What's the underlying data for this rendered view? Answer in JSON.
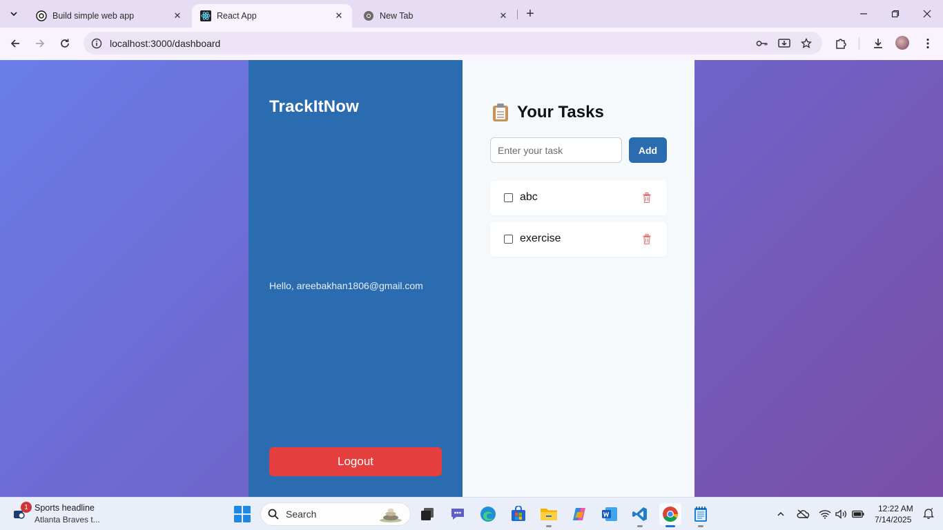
{
  "browser": {
    "tabs": [
      {
        "title": "Build simple web app",
        "active": false
      },
      {
        "title": "React App",
        "active": true
      },
      {
        "title": "New Tab",
        "active": false
      }
    ],
    "url": "localhost:3000/dashboard"
  },
  "app": {
    "brand": "TrackItNow",
    "greeting": "Hello, areebakhan1806@gmail.com",
    "logout_label": "Logout",
    "heading_icon": "📋",
    "heading": "Your Tasks",
    "input": {
      "placeholder": "Enter your task",
      "value": ""
    },
    "add_label": "Add",
    "tasks": [
      {
        "label": "abc",
        "checked": false
      },
      {
        "label": "exercise",
        "checked": false
      }
    ],
    "colors": {
      "sidebar": "#2b6cb0",
      "logout": "#e53e3e",
      "add_button": "#2b6cb0",
      "delete_icon": "#e57373"
    }
  },
  "taskbar": {
    "news_title": "Sports headline",
    "news_subtitle": "Atlanta Braves t...",
    "news_badge": "1",
    "search_label": "Search",
    "time": "12:22 AM",
    "date": "7/14/2025"
  }
}
